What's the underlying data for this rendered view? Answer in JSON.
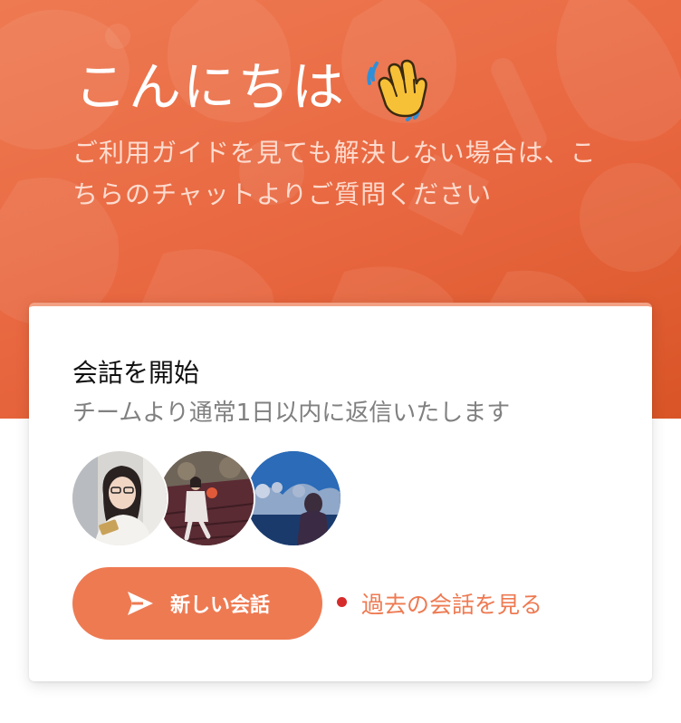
{
  "header": {
    "greeting": "こんにちは",
    "greeting_icon": "waving-hand-icon",
    "subtitle": "ご利用ガイドを見ても解決しない場合は、こちらのチャットよりご質問ください",
    "background_color": "#e8663f"
  },
  "card": {
    "title": "会話を開始",
    "subtitle": "チームより通常1日以内に返信いたします",
    "avatars": [
      {
        "name": "team-avatar-1"
      },
      {
        "name": "team-avatar-2"
      },
      {
        "name": "team-avatar-3"
      }
    ],
    "new_conversation_button": {
      "label": "新しい会話",
      "icon": "send-icon",
      "color": "#ee7a52"
    },
    "past_conversations_link": {
      "label": "過去の会話を見る",
      "indicator_color": "#d62b2b"
    }
  }
}
